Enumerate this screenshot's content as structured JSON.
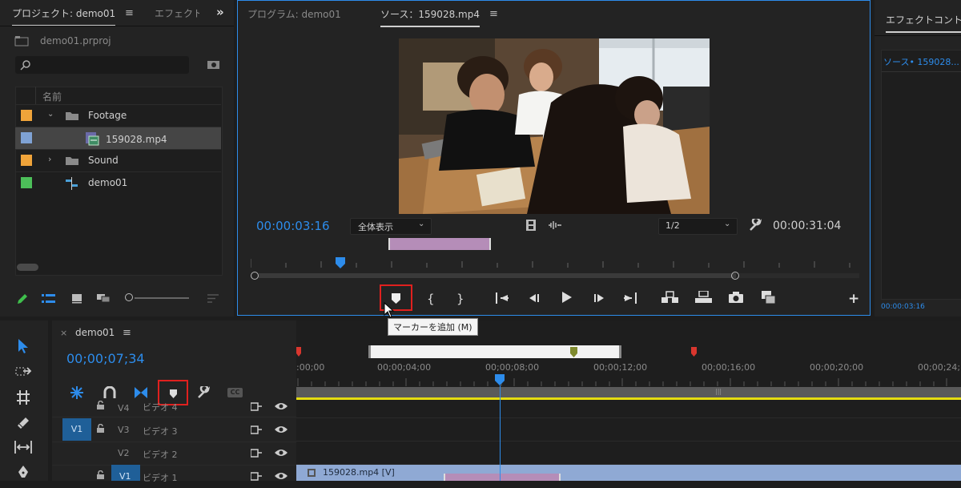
{
  "project_panel": {
    "tab_title": "プロジェクト: demo01",
    "tab_effects": "エフェクト",
    "project_file": "demo01.prproj",
    "search_placeholder": "",
    "column_name": "名前",
    "items": [
      {
        "label": "Footage",
        "color": "#f0a43a",
        "kind": "folder",
        "expanded": true
      },
      {
        "label": "159028.mp4",
        "color": "#7fa2d4",
        "kind": "clip",
        "selected": true
      },
      {
        "label": "Sound",
        "color": "#f0a43a",
        "kind": "folder",
        "expanded": false
      },
      {
        "label": "demo01",
        "color": "#4cbf59",
        "kind": "sequence"
      }
    ]
  },
  "monitor": {
    "tab_program": "プログラム: demo01",
    "tab_source": "ソース：159028.mp4",
    "current_time": "00:00:03:16",
    "zoom_select": "全体表示",
    "resolution_select": "1/2",
    "duration": "00:00:31:04",
    "tooltip": "マーカーを追加 (M)",
    "accent": "#2d8ceb"
  },
  "effect_controls": {
    "tab_title": "エフェクトコント",
    "source_label": "ソース• 159028...",
    "timecode": "00:00:03:16"
  },
  "timeline": {
    "tab_title": "demo01",
    "timecode": "00;00;07;34",
    "ruler_labels": [
      ":00;00",
      "00;00;04;00",
      "00;00;08;00",
      "00;00;12;00",
      "00;00;16;00",
      "00;00;20;00",
      "00;00;24;"
    ],
    "tracks": [
      {
        "name": "V4",
        "label": "ビデオ 4",
        "source_patch": ""
      },
      {
        "name": "V3",
        "label": "ビデオ 3",
        "source_patch": "V1"
      },
      {
        "name": "V2",
        "label": "ビデオ 2",
        "source_patch": ""
      },
      {
        "name": "V1",
        "label": "ビデオ 1",
        "source_patch": "",
        "highlight": true
      }
    ],
    "clip_label": "159028.mp4 [V]",
    "work_area_marker": "|||"
  }
}
